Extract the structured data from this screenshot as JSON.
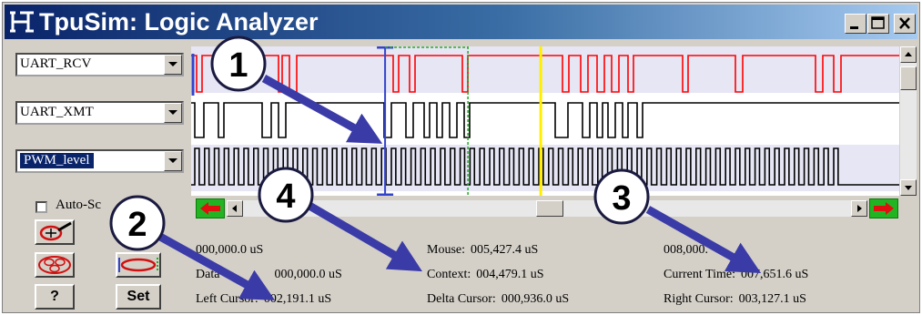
{
  "window": {
    "title": "TpuSim: Logic Analyzer",
    "controls": [
      "minimize-icon",
      "maximize-icon",
      "close-icon"
    ]
  },
  "signals": [
    {
      "name": "UART_RCV",
      "selected": false,
      "color": "#ff0000"
    },
    {
      "name": "UART_XMT",
      "selected": false,
      "color": "#000000"
    },
    {
      "name": "PWM_level",
      "selected": true,
      "color": "#000000"
    }
  ],
  "options": {
    "auto_scroll_label": "Auto-Sc"
  },
  "toolbar": {
    "help_label": "?",
    "set_label": "Set",
    "icons": [
      "zoom-cursor-icon",
      "zoom-out-icon",
      "select-range-icon"
    ]
  },
  "info": {
    "start_time": "000,000.0 uS",
    "data_label": "Data",
    "data_value": "000,000.0 uS",
    "left_cursor_label": "Left Cursor:",
    "left_cursor_value": "002,191.1 uS",
    "mouse_label": "Mouse:",
    "mouse_value": "005,427.4 uS",
    "context_label": "Context:",
    "context_value": "004,479.1 uS",
    "delta_cursor_label": "Delta Cursor:",
    "delta_cursor_value": "000,936.0 uS",
    "end_time": "008,000.",
    "current_time_label": "Current Time:",
    "current_time_value": "007,651.6 uS",
    "right_cursor_label": "Right Cursor:",
    "right_cursor_value": "003,127.1 uS"
  },
  "cursors": {
    "left_us": 2191.1,
    "right_us": 3127.1,
    "current_us": 3950,
    "left_color": "#3344cc",
    "right_color": "#22aa22",
    "current_color": "#ffee00"
  },
  "callouts": [
    "1",
    "2",
    "3",
    "4"
  ],
  "colors": {
    "titlebar": "#0a246a",
    "callout_arrow": "#3b3ba8",
    "band": "#e6e6f5"
  }
}
